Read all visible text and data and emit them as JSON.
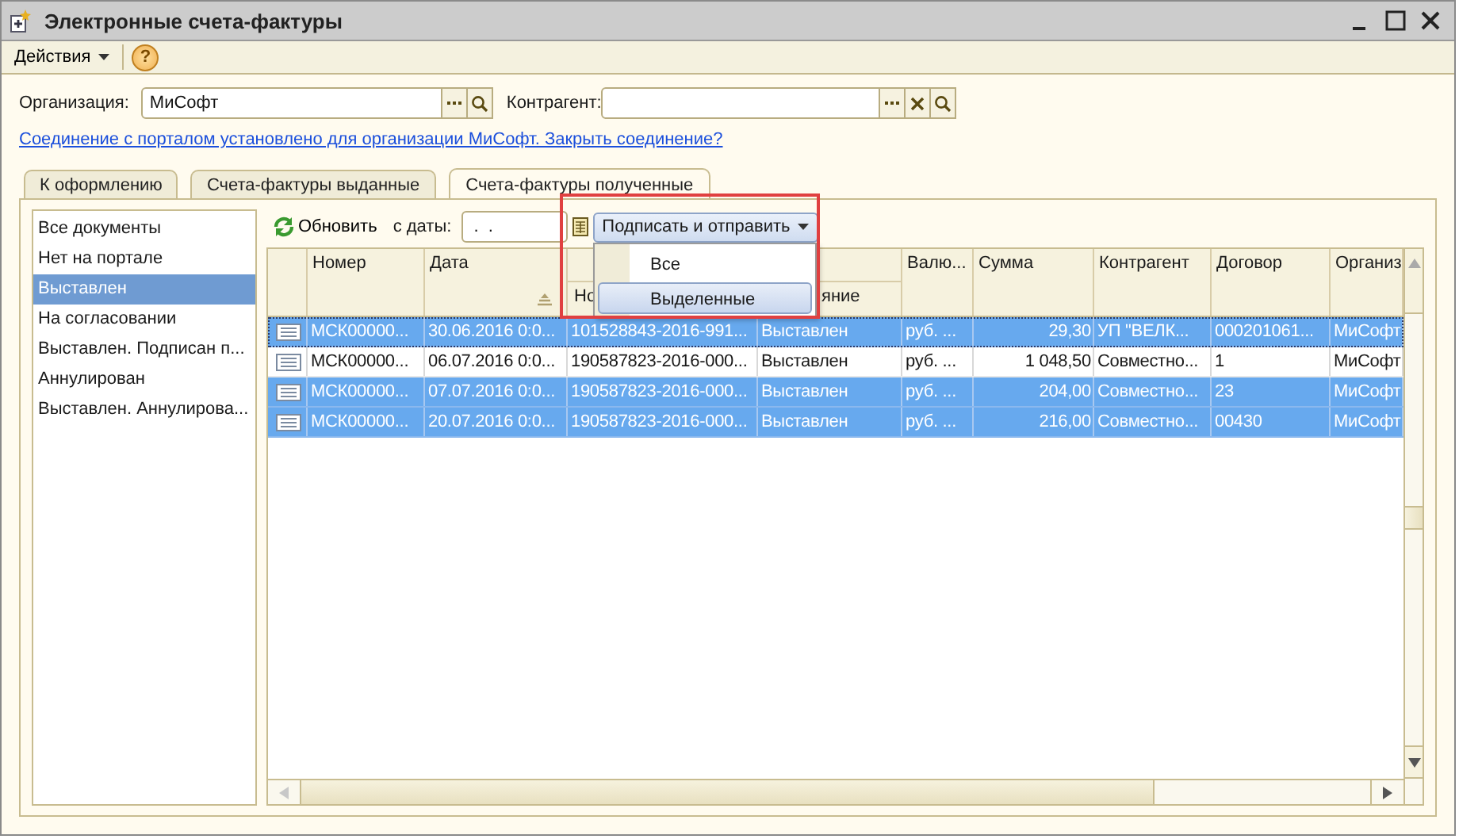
{
  "window": {
    "title": "Электронные счета-фактуры"
  },
  "toolbar": {
    "actions": "Действия",
    "help": "?"
  },
  "filters": {
    "organization_label": "Организация:",
    "organization_value": "МиСофт",
    "counterparty_label": "Контрагент:"
  },
  "link": "Соединение с порталом установлено для организации МиСофт. Закрыть соединение?",
  "tabs": [
    {
      "label": "К оформлению",
      "selected": false
    },
    {
      "label": "Счета-фактуры выданные",
      "selected": false
    },
    {
      "label": "Счета-фактуры полученные",
      "selected": true
    }
  ],
  "statuses": [
    {
      "label": "Все документы",
      "selected": false
    },
    {
      "label": "Нет на портале",
      "selected": false
    },
    {
      "label": "Выставлен",
      "selected": true
    },
    {
      "label": "На согласовании",
      "selected": false
    },
    {
      "label": "Выставлен. Подписан п...",
      "selected": false
    },
    {
      "label": "Аннулирован",
      "selected": false
    },
    {
      "label": "Выставлен. Аннулирова...",
      "selected": false
    }
  ],
  "table_toolbar": {
    "refresh": "Обновить",
    "date_label": "с даты:",
    "date_value": " .  .",
    "sign_button": "Подписать и отправить"
  },
  "sign_menu": [
    {
      "label": "Все",
      "selected": false
    },
    {
      "label": "Выделенные",
      "selected": true
    }
  ],
  "table": {
    "columns": [
      "Номер",
      "Дата",
      "Но",
      "яние",
      "Валю...",
      "Сумма",
      "Контрагент",
      "Договор",
      "Организ"
    ],
    "rows": [
      {
        "selected": true,
        "focused": true,
        "cells": [
          "МСК00000...",
          "30.06.2016 0:0...",
          "101528843-2016-991...",
          "Выставлен",
          "руб. ...",
          "29,30",
          "УП \"ВЕЛК...",
          "000201061...",
          "МиСофт"
        ]
      },
      {
        "selected": false,
        "focused": false,
        "cells": [
          "МСК00000...",
          "06.07.2016 0:0...",
          "190587823-2016-000...",
          "Выставлен",
          "руб. ...",
          "1 048,50",
          "Совместно...",
          "1",
          "МиСофт"
        ]
      },
      {
        "selected": true,
        "focused": false,
        "cells": [
          "МСК00000...",
          "07.07.2016 0:0...",
          "190587823-2016-000...",
          "Выставлен",
          "руб. ...",
          "204,00",
          "Совместно...",
          "23",
          "МиСофт"
        ]
      },
      {
        "selected": true,
        "focused": false,
        "cells": [
          "МСК00000...",
          "20.07.2016 0:0...",
          "190587823-2016-000...",
          "Выставлен",
          "руб. ...",
          "216,00",
          "Совместно...",
          "00430",
          "МиСофт"
        ]
      }
    ]
  }
}
